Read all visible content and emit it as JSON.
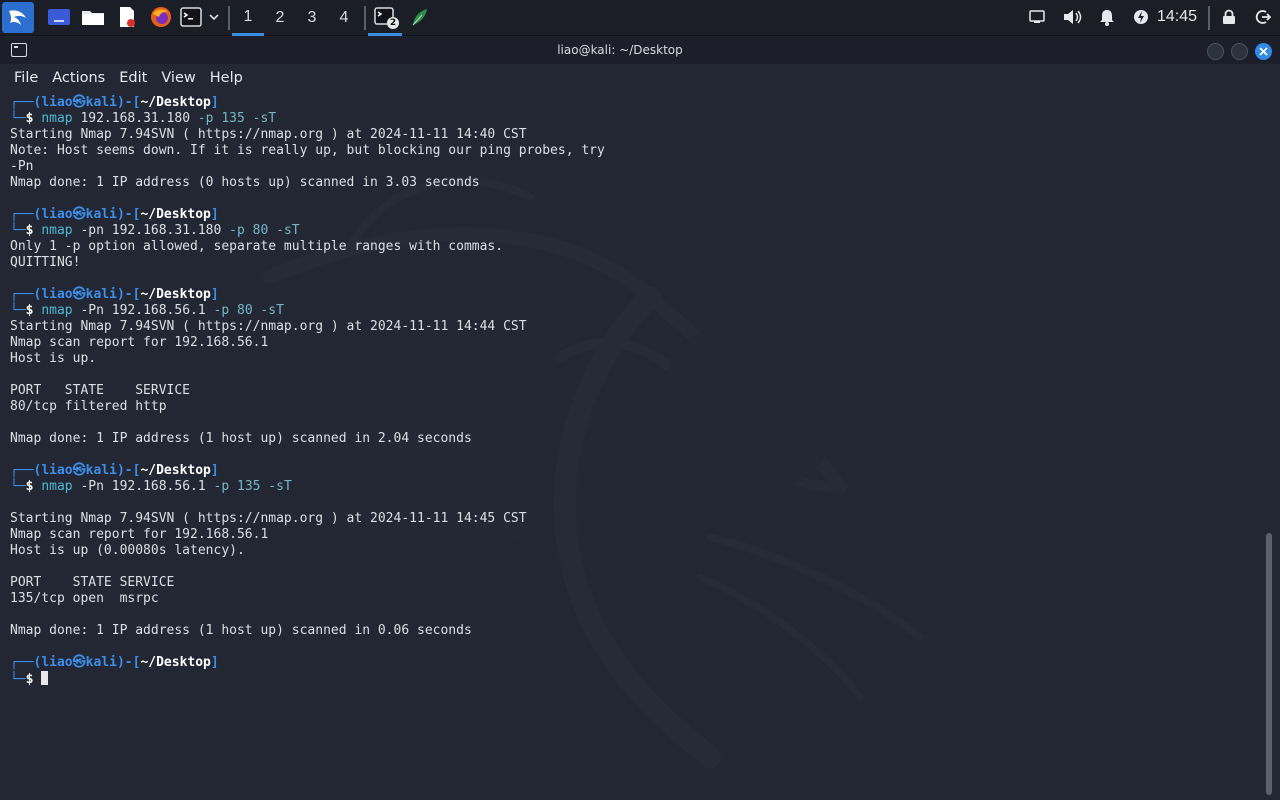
{
  "taskbar": {
    "workspaces": [
      "1",
      "2",
      "3",
      "4"
    ],
    "active_workspace": 0,
    "terminal_badge": "2",
    "clock": "14:45",
    "accent": "#3a8dde"
  },
  "window": {
    "title": "liao@kali: ~/Desktop"
  },
  "menubar": {
    "items": [
      "File",
      "Actions",
      "Edit",
      "View",
      "Help"
    ]
  },
  "prompt": {
    "top_prefix": "┌──(",
    "user": "liao",
    "at": "㉿",
    "host": "kali",
    "mid": ")-[",
    "path": "~/Desktop",
    "end": "]",
    "bottom_prefix": "└─",
    "dollar": "$"
  },
  "terminal": {
    "blocks": [
      {
        "cmd": "nmap",
        "args": " 192.168.31.180 ",
        "rest": "-p 135 -sT",
        "output": [
          "Starting Nmap 7.94SVN ( https://nmap.org ) at 2024-11-11 14:40 CST",
          "Note: Host seems down. If it is really up, but blocking our ping probes, try",
          "-Pn",
          "Nmap done: 1 IP address (0 hosts up) scanned in 3.03 seconds",
          ""
        ]
      },
      {
        "cmd": "nmap",
        "args": " -pn 192.168.31.180 ",
        "rest": "-p 80 -sT",
        "output": [
          "Only 1 -p option allowed, separate multiple ranges with commas.",
          "QUITTING!",
          ""
        ]
      },
      {
        "cmd": "nmap",
        "args": " -Pn 192.168.56.1 ",
        "rest": "-p 80 -sT",
        "output": [
          "Starting Nmap 7.94SVN ( https://nmap.org ) at 2024-11-11 14:44 CST",
          "Nmap scan report for 192.168.56.1",
          "Host is up.",
          "",
          "PORT   STATE    SERVICE",
          "80/tcp filtered http",
          "",
          "Nmap done: 1 IP address (1 host up) scanned in 2.04 seconds",
          ""
        ]
      },
      {
        "cmd": "nmap",
        "args": " -Pn 192.168.56.1 ",
        "rest": "-p 135 -sT",
        "output": [
          "",
          "Starting Nmap 7.94SVN ( https://nmap.org ) at 2024-11-11 14:45 CST",
          "Nmap scan report for 192.168.56.1",
          "Host is up (0.00080s latency).",
          "",
          "PORT    STATE SERVICE",
          "135/tcp open  msrpc",
          "",
          "Nmap done: 1 IP address (1 host up) scanned in 0.06 seconds",
          ""
        ]
      }
    ]
  }
}
